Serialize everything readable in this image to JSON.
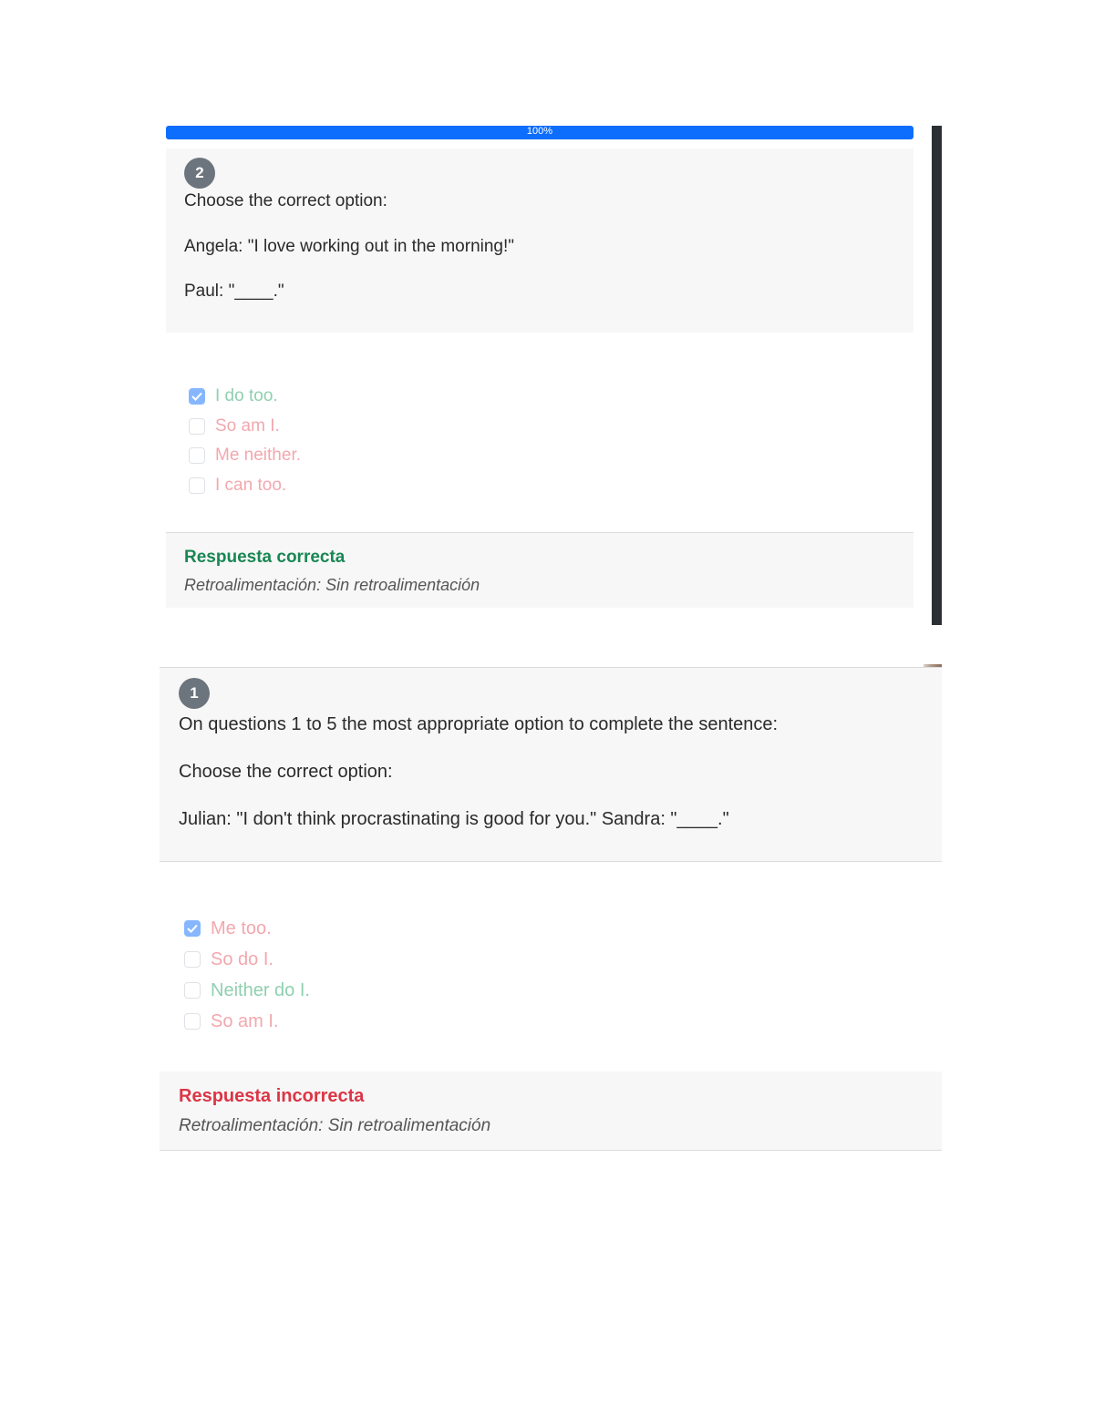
{
  "progress": {
    "label": "100%",
    "value": 1.0,
    "color": "#0d6efd"
  },
  "questions": [
    {
      "number": "2",
      "lines": [
        "Choose the correct option:",
        "Angela: \"I love working out in the morning!\"",
        "Paul: \"____.\""
      ],
      "options": [
        {
          "label": "I do too.",
          "checked": true,
          "state": "correct"
        },
        {
          "label": "So am I.",
          "checked": false,
          "state": "incorrect"
        },
        {
          "label": "Me neither.",
          "checked": false,
          "state": "incorrect"
        },
        {
          "label": "I can too.",
          "checked": false,
          "state": "incorrect"
        }
      ],
      "feedback": {
        "title": "Respuesta correcta",
        "text": "Retroalimentación: Sin retroalimentación",
        "color": "#198754"
      }
    },
    {
      "number": "1",
      "lines": [
        "On questions 1 to 5 the most appropriate option to complete the sentence:",
        "Choose the correct option:",
        "Julian: \"I don't think procrastinating is good for you.\" Sandra: \"____.\""
      ],
      "options": [
        {
          "label": "Me too.",
          "checked": true,
          "state": "incorrect"
        },
        {
          "label": "So do I.",
          "checked": false,
          "state": "incorrect"
        },
        {
          "label": "Neither do I.",
          "checked": false,
          "state": "correct"
        },
        {
          "label": "So am I.",
          "checked": false,
          "state": "incorrect"
        }
      ],
      "feedback": {
        "title": "Respuesta incorrecta",
        "text": "Retroalimentación: Sin retroalimentación",
        "color": "#dc3545"
      }
    }
  ],
  "icons": {
    "checkbox_checked": "checkmark-icon"
  }
}
